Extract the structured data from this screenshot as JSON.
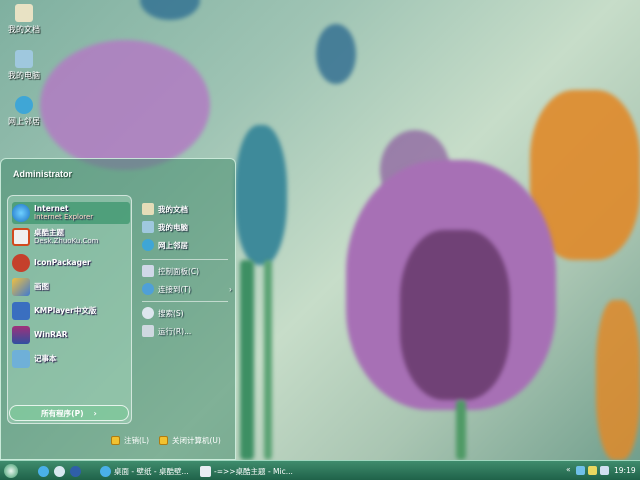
{
  "desktop": {
    "icons": [
      {
        "label": "我的文档",
        "icon": "documents-folder-icon"
      },
      {
        "label": "我的电脑",
        "icon": "computer-icon"
      },
      {
        "label": "网上邻居",
        "icon": "network-icon"
      }
    ]
  },
  "start_menu": {
    "user_name": "Administrator",
    "pinned": [
      {
        "title": "Internet",
        "subtitle": "Internet Explorer",
        "icon": "internet-explorer-icon"
      },
      {
        "title": "桌酷主题",
        "subtitle": "Desk.ZhuoKu.Com",
        "icon": "zhuoku-theme-icon"
      }
    ],
    "recent": [
      {
        "title": "IconPackager",
        "icon": "iconpackager-icon"
      },
      {
        "title": "画图",
        "icon": "paint-icon"
      },
      {
        "title": "KMPlayer中文版",
        "icon": "kmplayer-icon"
      },
      {
        "title": "WinRAR",
        "icon": "winrar-icon"
      },
      {
        "title": "记事本",
        "icon": "notepad-icon"
      }
    ],
    "all_programs_label": "所有程序(P)",
    "all_programs_arrow": "›",
    "places": [
      {
        "label": "我的文档",
        "icon": "documents-icon"
      },
      {
        "label": "我的电脑",
        "icon": "computer-icon"
      },
      {
        "label": "网上邻居",
        "icon": "network-icon"
      }
    ],
    "settings": [
      {
        "label": "控制面板(C)",
        "icon": "control-panel-icon"
      },
      {
        "label": "连接到(T)",
        "icon": "connect-to-icon",
        "arrow": "›"
      }
    ],
    "tools": [
      {
        "label": "搜索(S)",
        "icon": "search-icon"
      },
      {
        "label": "运行(R)...",
        "icon": "run-icon"
      }
    ],
    "logoff_label": "注销(L)",
    "shutdown_label": "关闭计算机(U)"
  },
  "taskbar": {
    "tasks": [
      {
        "label": "桌面 - 壁纸 - 桌酷壁...",
        "icon": "browser-icon"
      },
      {
        "label": "-=>>桌酷主题 - Mic...",
        "icon": "document-icon"
      }
    ],
    "overflow": "«",
    "clock": "19:19"
  },
  "colors": {
    "taskbar": "#2f7a5c",
    "accent": "#5ab08a",
    "highlight": "#3c966e"
  }
}
